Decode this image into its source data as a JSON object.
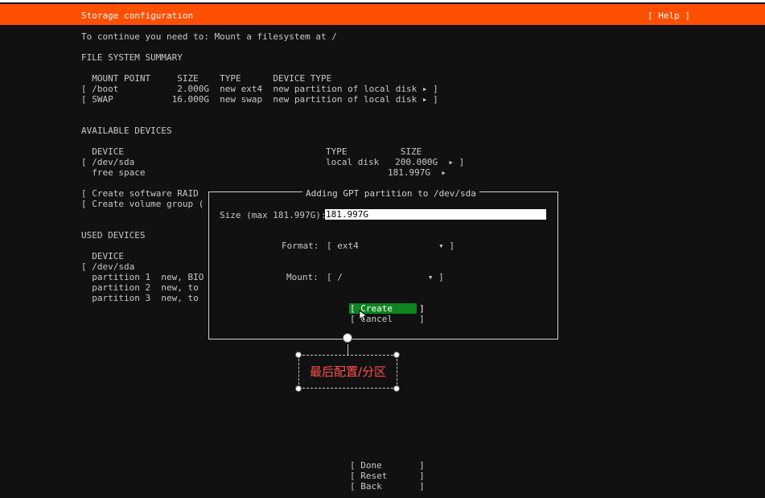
{
  "header": {
    "title": "Storage configuration",
    "help": "[ Help ]"
  },
  "instruction": "To continue you need to: Mount a filesystem at /",
  "fs_summary": {
    "heading": "FILE SYSTEM SUMMARY",
    "columns": "  MOUNT POINT     SIZE    TYPE      DEVICE TYPE",
    "rows": [
      "[ /boot           2.000G  new ext4  new partition of local disk ▸ ]",
      "[ SWAP           16.000G  new swap  new partition of local disk ▸ ]"
    ]
  },
  "available": {
    "heading": "AVAILABLE DEVICES",
    "col_device": "  DEVICE",
    "col_type_size": "TYPE          SIZE",
    "row1_left": "[ /dev/sda",
    "row1_right": "local disk   200.000G  ▸ ]",
    "row2_left": "  free space",
    "row2_right": "181.997G  ▸",
    "raid": "[ Create software RAID",
    "vg": "[ Create volume group ("
  },
  "used": {
    "heading": "USED DEVICES",
    "col_device": "  DEVICE",
    "rows": [
      "[ /dev/sda",
      "  partition 1  new, BIO",
      "  partition 2  new, to",
      "  partition 3  new, to"
    ]
  },
  "dialog": {
    "title": "Adding GPT partition to /dev/sda",
    "size_label": "Size (max 181.997G):",
    "size_value": "181.997G",
    "format_label": "Format:",
    "format_value": "[ ext4               ▾ ]",
    "mount_label": "Mount:",
    "mount_value": "[ /                ▾ ]",
    "create": "[ Create     ]",
    "cancel": "[ Cancel     ]"
  },
  "annotation": "最后配置/分区",
  "footer": {
    "done": "[ Done       ]",
    "reset": "[ Reset      ]",
    "back": "[ Back       ]"
  },
  "colors": {
    "header_bg": "#ff4f00",
    "screen_bg": "#111111",
    "create_bg": "#0e8420",
    "annotation_text": "#ff5050"
  }
}
